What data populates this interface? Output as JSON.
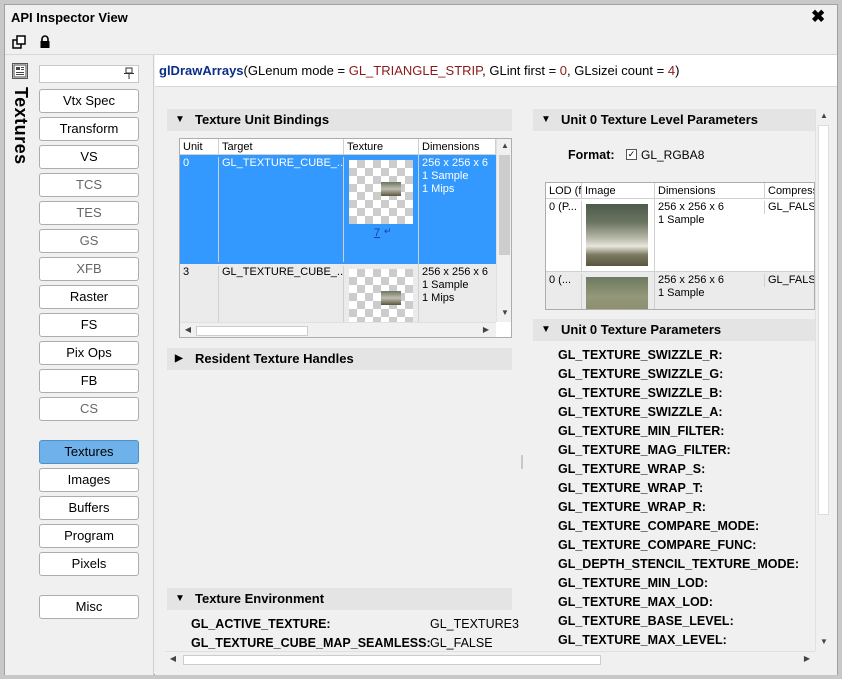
{
  "window": {
    "title": "API Inspector View",
    "close_glyph": "✖"
  },
  "toolbar": {
    "undock_icon": "undock-icon",
    "lock_icon": "lock-icon"
  },
  "sidebar": {
    "vertical_tab": "Textures",
    "filter_value": "",
    "pin_glyph": "⊥",
    "buttons": [
      "Vtx Spec",
      "Transform",
      "VS",
      "TCS",
      "TES",
      "GS",
      "XFB",
      "Raster",
      "FS",
      "Pix Ops",
      "FB",
      "CS",
      "Textures",
      "Images",
      "Buffers",
      "Program",
      "Pixels",
      "Misc"
    ],
    "active": "Textures"
  },
  "call": {
    "name": "glDrawArrays",
    "open": "(",
    "p1": "GLenum mode = ",
    "v1": "GL_TRIANGLE_STRIP",
    "p2": ", GLint first = ",
    "v2": "0",
    "p3": ", GLsizei count = ",
    "v3": "4",
    "close": ")"
  },
  "unit_bindings": {
    "title": "Texture Unit Bindings",
    "columns": [
      "Unit",
      "Target",
      "Texture",
      "Dimensions"
    ],
    "rows": [
      {
        "unit": "0",
        "target": "GL_TEXTURE_CUBE_...",
        "texture_link": "7",
        "dim1": "256 x 256 x 6",
        "dim2": "1 Sample",
        "dim3": "1 Mips"
      },
      {
        "unit": "3",
        "target": "GL_TEXTURE_CUBE_...",
        "texture_link": "",
        "dim1": "256 x 256 x 6",
        "dim2": "1 Sample",
        "dim3": "1 Mips"
      }
    ]
  },
  "resident_handles": {
    "title": "Resident Texture Handles"
  },
  "environment": {
    "title": "Texture Environment",
    "rows": [
      {
        "name": "GL_ACTIVE_TEXTURE:",
        "value": "GL_TEXTURE3"
      },
      {
        "name": "GL_TEXTURE_CUBE_MAP_SEAMLESS:",
        "value": "GL_FALSE"
      }
    ]
  },
  "level_params": {
    "title": "Unit 0 Texture Level Parameters",
    "format_label": "Format:",
    "format_value": "GL_RGBA8",
    "columns": [
      "LOD (f",
      "Image",
      "Dimensions",
      "Compress"
    ],
    "rows": [
      {
        "lod": "0 (P...",
        "dim1": "256 x 256 x 6",
        "dim2": "1 Sample",
        "compressed": "GL_FALSE"
      },
      {
        "lod": "0 (...",
        "dim1": "256 x 256 x 6",
        "dim2": "1 Sample",
        "compressed": "GL_FALSE"
      }
    ]
  },
  "tex_params": {
    "title": "Unit 0 Texture Parameters",
    "items": [
      "GL_TEXTURE_SWIZZLE_R:",
      "GL_TEXTURE_SWIZZLE_G:",
      "GL_TEXTURE_SWIZZLE_B:",
      "GL_TEXTURE_SWIZZLE_A:",
      "GL_TEXTURE_MIN_FILTER:",
      "GL_TEXTURE_MAG_FILTER:",
      "GL_TEXTURE_WRAP_S:",
      "GL_TEXTURE_WRAP_T:",
      "GL_TEXTURE_WRAP_R:",
      "GL_TEXTURE_COMPARE_MODE:",
      "GL_TEXTURE_COMPARE_FUNC:",
      "GL_DEPTH_STENCIL_TEXTURE_MODE:",
      "GL_TEXTURE_MIN_LOD:",
      "GL_TEXTURE_MAX_LOD:",
      "GL_TEXTURE_BASE_LEVEL:",
      "GL_TEXTURE_MAX_LEVEL:"
    ]
  },
  "colors": {
    "accent": "#6eb1eb",
    "selection": "#3399ff",
    "function_name": "#0a2e87",
    "param_value": "#8b1a1a"
  }
}
